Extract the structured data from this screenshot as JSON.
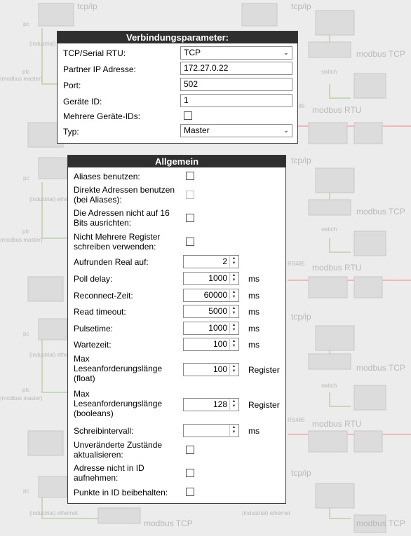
{
  "background": {
    "texts": [
      "tcp/ip",
      "pc",
      "(industrial) ethernet",
      "plc",
      "(modbus master)",
      "modbus TCP",
      "switch",
      "modbus RTU",
      "RS485"
    ]
  },
  "connection_panel": {
    "title": "Verbindungsparameter:",
    "protocol_label": "TCP/Serial RTU:",
    "protocol_value": "TCP",
    "ip_label": "Partner IP Adresse:",
    "ip_value": "172.27.0.22",
    "port_label": "Port:",
    "port_value": "502",
    "device_id_label": "Geräte ID:",
    "device_id_value": "1",
    "multi_ids_label": "Mehrere Geräte-IDs:",
    "type_label": "Typ:",
    "type_value": "Master"
  },
  "general_panel": {
    "title": "Allgemein",
    "aliases_label": "Aliases benutzen:",
    "direct_addr_label": "Direkte Adressen benutzen (bei Aliases):",
    "no_align_label": "Die Adressen nicht auf 16 Bits ausrichten:",
    "no_multi_reg_label": "Nicht Mehrere Register schreiben verwenden:",
    "round_label": "Aufrunden Real auf:",
    "round_value": "2",
    "poll_label": "Poll delay:",
    "poll_value": "1000",
    "poll_unit": "ms",
    "reconnect_label": "Reconnect-Zeit:",
    "reconnect_value": "60000",
    "reconnect_unit": "ms",
    "read_timeout_label": "Read timeout:",
    "read_timeout_value": "5000",
    "read_timeout_unit": "ms",
    "pulsetime_label": "Pulsetime:",
    "pulsetime_value": "1000",
    "pulsetime_unit": "ms",
    "wait_label": "Wartezeit:",
    "wait_value": "100",
    "wait_unit": "ms",
    "max_float_label": "Max Leseanforderungslänge (float)",
    "max_float_value": "100",
    "max_float_unit": "Register",
    "max_bool_label": "Max Leseanforderungslänge (booleans)",
    "max_bool_value": "128",
    "max_bool_unit": "Register",
    "write_interval_label": "Schreibintervall:",
    "write_interval_value": "",
    "write_interval_unit": "ms",
    "update_unchanged_label": "Unveränderte Zustände aktualisieren:",
    "addr_not_in_id_label": "Adresse nicht in ID aufnehmen:",
    "keep_points_label": "Punkte in ID beibehalten:"
  }
}
